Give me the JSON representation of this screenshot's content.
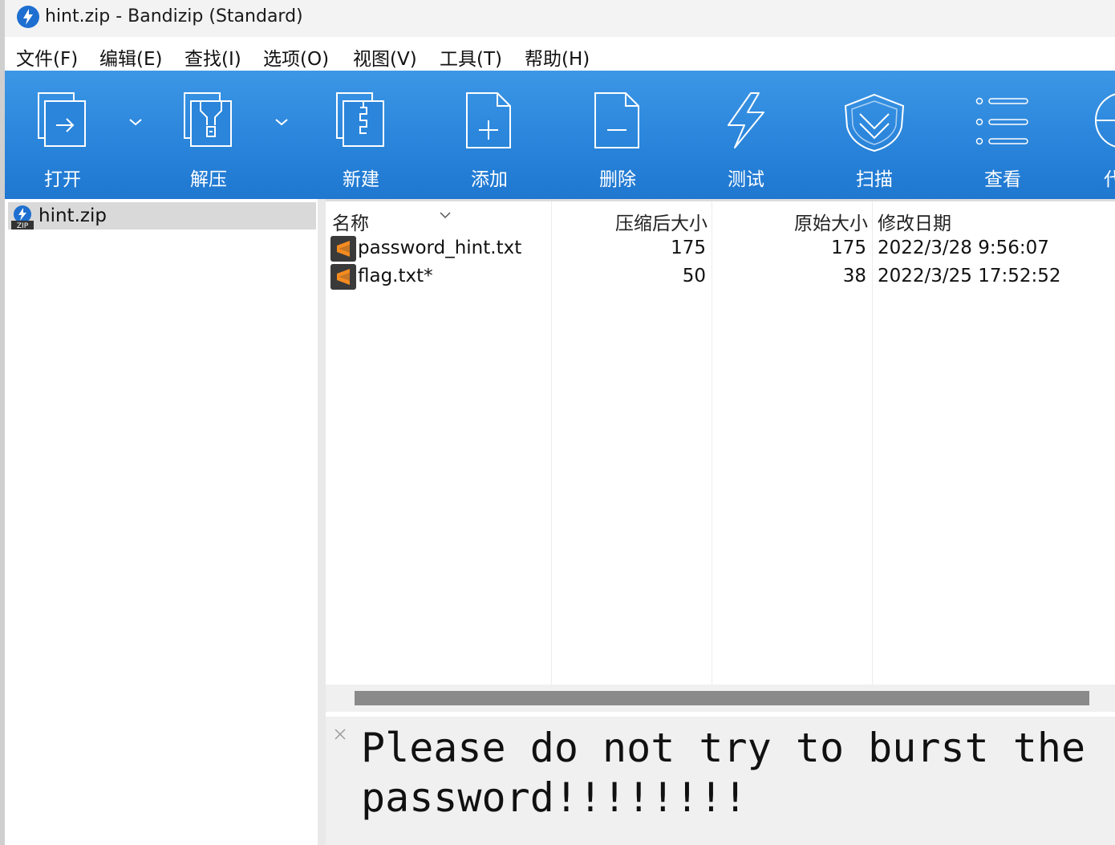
{
  "window": {
    "title": "hint.zip - Bandizip (Standard)"
  },
  "menu": {
    "items": [
      "文件(F)",
      "编辑(E)",
      "查找(I)",
      "选项(O)",
      "视图(V)",
      "工具(T)",
      "帮助(H)"
    ]
  },
  "toolbar": {
    "open": "打开",
    "extract": "解压",
    "new": "新建",
    "add": "添加",
    "delete": "删除",
    "test": "测试",
    "scan": "扫描",
    "view": "查看",
    "code": "代"
  },
  "tree": {
    "root": "hint.zip",
    "root_icon_text": "ZIP"
  },
  "file_list": {
    "columns": {
      "name": "名称",
      "compressed": "压缩后大小",
      "original": "原始大小",
      "modified": "修改日期"
    },
    "rows": [
      {
        "name": "password_hint.txt",
        "compressed": "175",
        "original": "175",
        "modified": "2022/3/28 9:56:07"
      },
      {
        "name": "flag.txt*",
        "compressed": "50",
        "original": "38",
        "modified": "2022/3/25 17:52:52"
      }
    ]
  },
  "comment": {
    "text": "Please do not try to burst the password!!!!!!!!"
  },
  "colors": {
    "toolbar_blue": "#2a85db",
    "file_icon_orange": "#f58b1f",
    "file_icon_bg": "#3a3a3a"
  }
}
